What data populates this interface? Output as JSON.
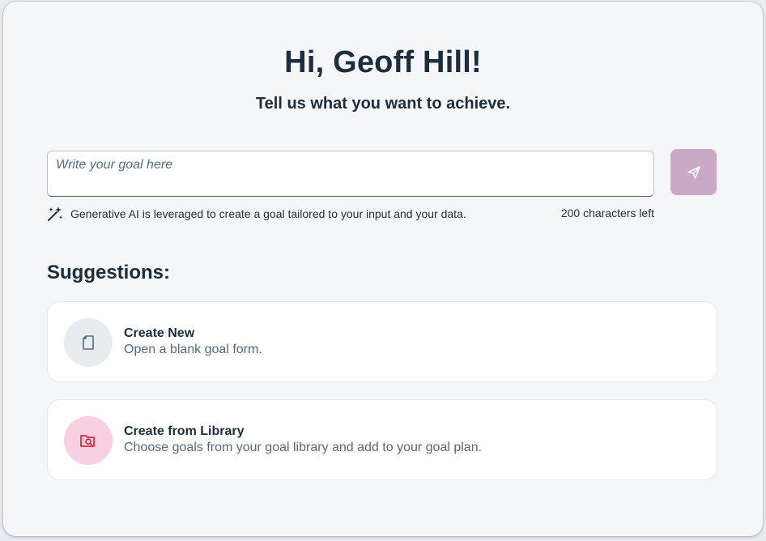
{
  "header": {
    "greeting": "Hi, Geoff Hill!",
    "subtitle": "Tell us what you want to achieve."
  },
  "goal_input": {
    "placeholder": "Write your goal here",
    "value": "",
    "send_label": "Send"
  },
  "ai_note": {
    "text": "Generative AI is leveraged to create a goal tailored to your input and your data.",
    "char_count": "200 characters left"
  },
  "suggestions": {
    "title": "Suggestions:",
    "items": [
      {
        "icon": "document-icon",
        "title": "Create New",
        "description": "Open a blank goal form."
      },
      {
        "icon": "library-search-icon",
        "title": "Create from Library",
        "description": "Choose goals from your goal library and add to your goal plan."
      }
    ]
  },
  "colors": {
    "send_button": "#c9a9c3",
    "create_new_circle": "#e9ecee",
    "library_circle": "#f8d0e1",
    "library_icon": "#d6293e",
    "text_primary": "#1d2d3e",
    "text_secondary": "#556b82"
  }
}
